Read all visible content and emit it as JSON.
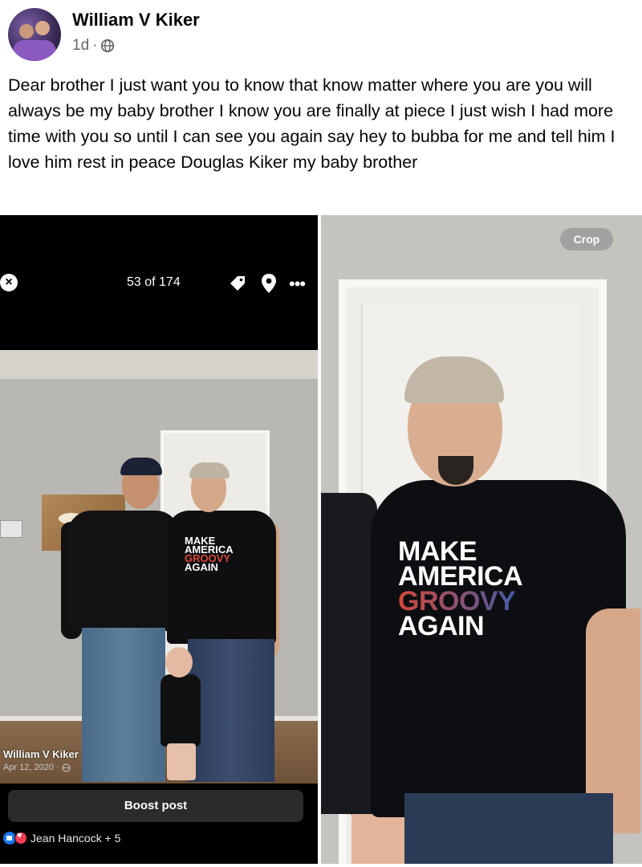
{
  "post": {
    "author": "William V Kiker",
    "time": "1d",
    "separator": "·",
    "text": "Dear brother I just want you to know that know matter where you are you will always be my baby brother I know you are finally at piece I just wish I had more time with you so until I can see you again say hey to bubba for me and tell him I love him rest in peace Douglas Kiker my baby brother"
  },
  "left_screenshot": {
    "counter": "53 of 174",
    "close_glyph": "×",
    "more_glyph": "•••",
    "shirt_lines": [
      "MAKE",
      "AMERICA",
      "GROOVY",
      "AGAIN"
    ],
    "caption_name": "William V Kiker",
    "caption_date": "Apr 12, 2020 ·",
    "boost_label": "Boost post",
    "reactions_text": "Jean Hancock + 5"
  },
  "right_photo": {
    "crop_label": "Crop",
    "shirt_lines": [
      "MAKE",
      "AMERICA",
      "GROOVY",
      "AGAIN"
    ]
  },
  "colors": {
    "text_primary": "#050505",
    "text_secondary": "#65676b",
    "like_blue": "#1877f2",
    "love_red": "#f33e58"
  },
  "icons": [
    "globe-icon",
    "close-icon",
    "tag-icon",
    "location-pin-icon",
    "more-icon",
    "like-icon",
    "love-icon"
  ]
}
